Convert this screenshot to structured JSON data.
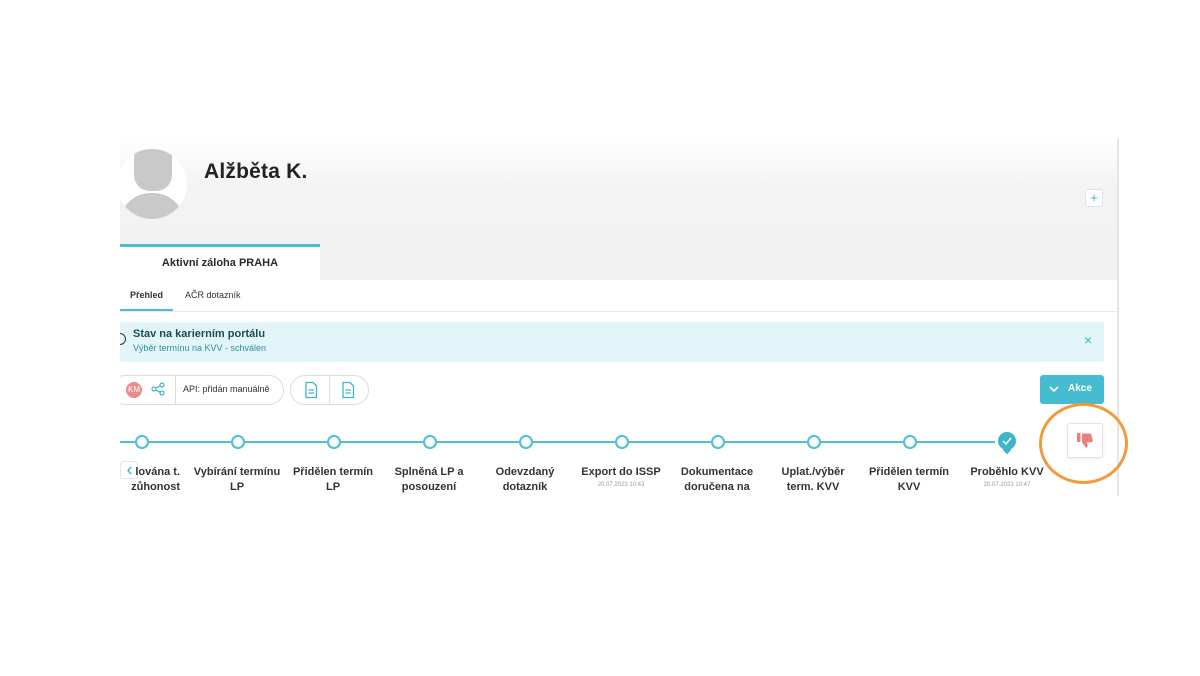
{
  "profile": {
    "name": "Alžběta K."
  },
  "header": {
    "add_label": "+"
  },
  "tabs": {
    "main": "Aktivní záloha PRAHA",
    "sub": [
      "Přehled",
      "AČR dotazník"
    ]
  },
  "notice": {
    "title": "Stav na karierním portálu",
    "subtitle": "Výběr termínu na KVV - schválen",
    "close": "×"
  },
  "toolbar": {
    "initials": "KM",
    "api_label": "API: přidán manuálně",
    "action_label": "Akce"
  },
  "timeline": {
    "steps": [
      {
        "line1": "lována t.",
        "line2": "zůhonost",
        "time": ""
      },
      {
        "line1": "Vybírání termínu",
        "line2": "LP",
        "time": ""
      },
      {
        "line1": "Přidělen termín",
        "line2": "LP",
        "time": ""
      },
      {
        "line1": "Splněná LP a",
        "line2": "posouzení",
        "time": ""
      },
      {
        "line1": "Odevzdaný",
        "line2": "dotazník",
        "time": ""
      },
      {
        "line1": "Export do ISSP",
        "line2": "",
        "time": "20.07.2023 10:43"
      },
      {
        "line1": "Dokumentace",
        "line2": "doručena na",
        "time": ""
      },
      {
        "line1": "Uplat./výběr",
        "line2": "term. KVV",
        "time": ""
      },
      {
        "line1": "Přidělen termín",
        "line2": "KVV",
        "time": ""
      },
      {
        "line1": "Proběhlo KVV",
        "line2": "",
        "time": "20.07.2023 10:47"
      }
    ]
  },
  "colors": {
    "accent": "#45bcd0",
    "notice_bg": "#e2f5f8",
    "initials_bg": "#e98c8c",
    "dislike_icon": "#e88080",
    "highlight": "#f39a3c"
  },
  "icons": [
    "share-icon",
    "document-icon",
    "chevron-down-icon",
    "chevron-left-icon",
    "check-icon",
    "thumbs-down-icon",
    "close-icon"
  ]
}
